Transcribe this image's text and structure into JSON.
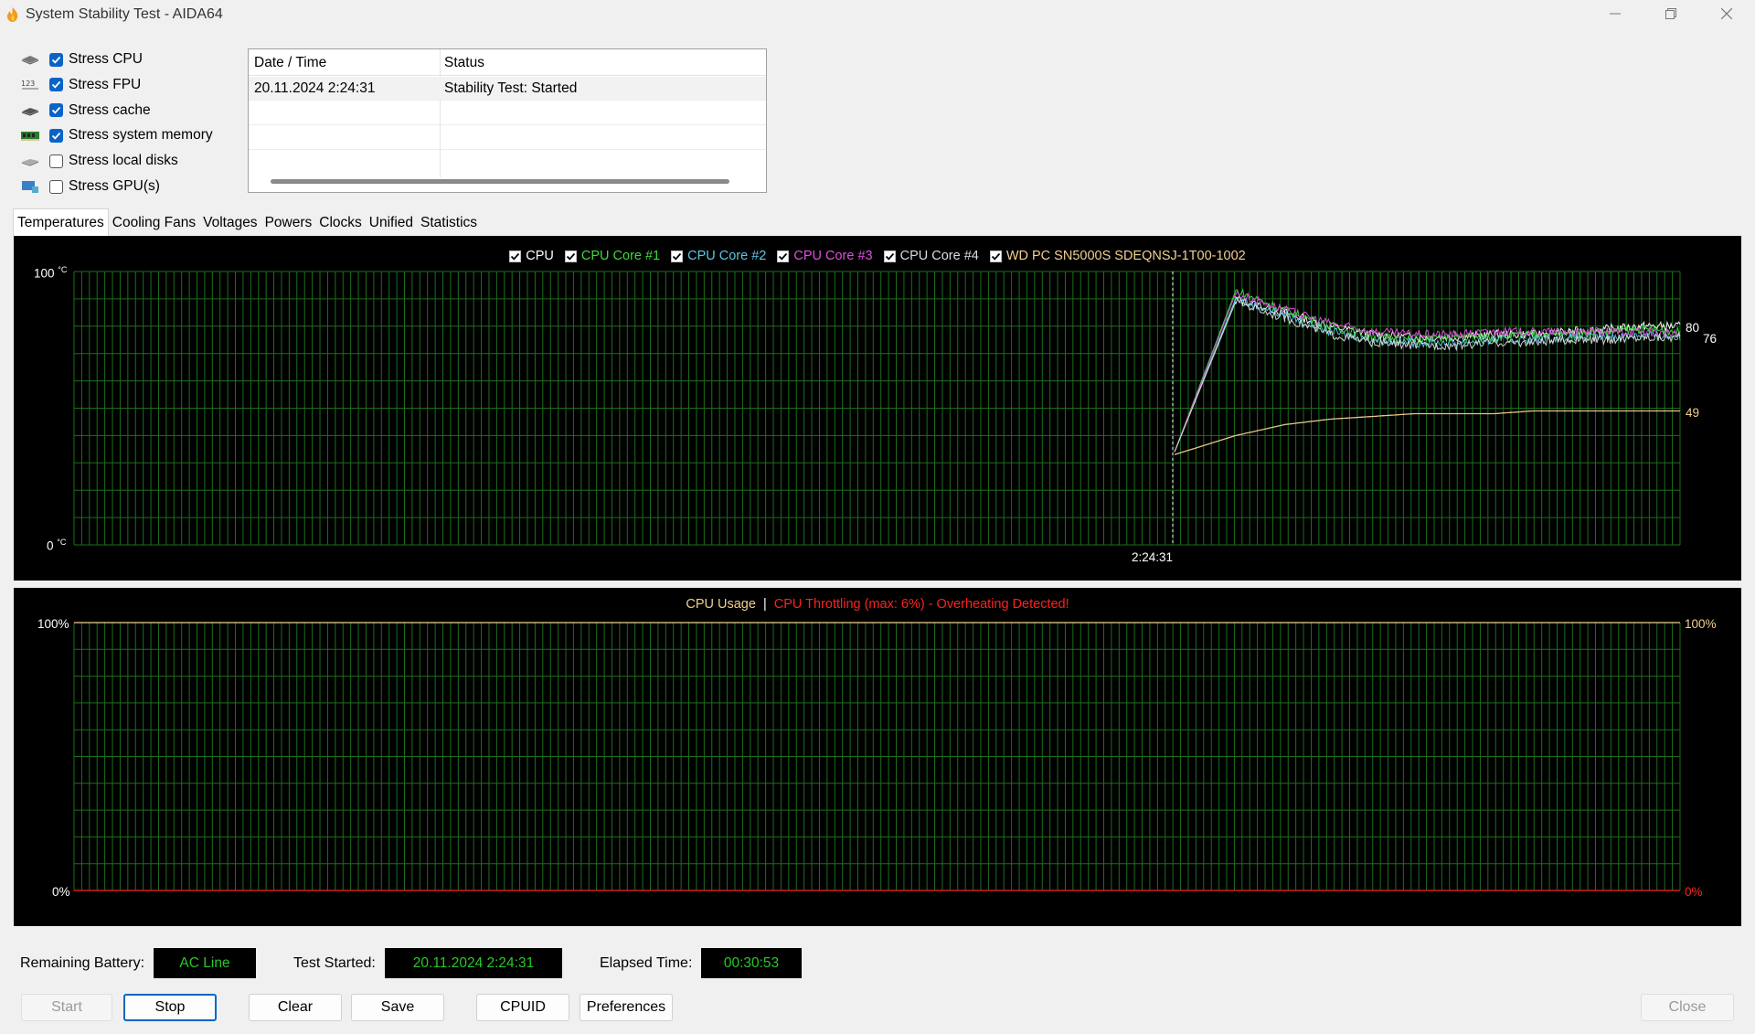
{
  "window": {
    "title": "System Stability Test - AIDA64"
  },
  "stress_options": [
    {
      "label": "Stress CPU",
      "checked": true,
      "icon": "cpu-chip-icon"
    },
    {
      "label": "Stress FPU",
      "checked": true,
      "icon": "fpu-123-icon"
    },
    {
      "label": "Stress cache",
      "checked": true,
      "icon": "cache-chip-icon"
    },
    {
      "label": "Stress system memory",
      "checked": true,
      "icon": "memory-module-icon"
    },
    {
      "label": "Stress local disks",
      "checked": false,
      "icon": "hard-disk-icon"
    },
    {
      "label": "Stress GPU(s)",
      "checked": false,
      "icon": "gpu-monitor-icon"
    }
  ],
  "log": {
    "columns": [
      "Date / Time",
      "Status"
    ],
    "rows": [
      [
        "20.11.2024 2:24:31",
        "Stability Test: Started"
      ]
    ]
  },
  "tabs": [
    "Temperatures",
    "Cooling Fans",
    "Voltages",
    "Powers",
    "Clocks",
    "Unified",
    "Statistics"
  ],
  "active_tab": "Temperatures",
  "temperature_chart": {
    "legend": [
      {
        "label": "CPU",
        "color": "#ffffff",
        "checked": true
      },
      {
        "label": "CPU Core #1",
        "color": "#3cdc3c",
        "checked": true
      },
      {
        "label": "CPU Core #2",
        "color": "#5ac8e6",
        "checked": true
      },
      {
        "label": "CPU Core #3",
        "color": "#e050e0",
        "checked": true
      },
      {
        "label": "CPU Core #4",
        "color": "#dcdcdc",
        "checked": true
      },
      {
        "label": "WD PC SN5000S SDEQNSJ-1T00-1002",
        "color": "#f0d090",
        "checked": true
      }
    ],
    "y_top_label": "100",
    "y_bottom_label": "0",
    "unit": "°C",
    "x_marker_label": "2:24:31",
    "current_values": [
      "80",
      "76",
      "49"
    ]
  },
  "usage_chart": {
    "title": "CPU Usage",
    "separator": "|",
    "throttle_text": "CPU Throttling (max: 6%) - Overheating Detected!",
    "left_top": "100%",
    "left_bottom": "0%",
    "right_top": "100%",
    "right_bottom": "0%"
  },
  "chart_data": [
    {
      "type": "line",
      "ylim": [
        0,
        100
      ],
      "x": [
        "2:24:31"
      ],
      "series": [
        {
          "name": "CPU",
          "values": [
            34,
            90,
            85,
            80,
            77,
            76,
            76,
            77,
            77,
            78,
            79,
            80,
            80
          ]
        },
        {
          "name": "CPU Core #1",
          "values": [
            34,
            93,
            86,
            80,
            76,
            75,
            76,
            76,
            77,
            77,
            78,
            79,
            78
          ]
        },
        {
          "name": "CPU Core #2",
          "values": [
            34,
            90,
            84,
            78,
            75,
            74,
            74,
            75,
            75,
            76,
            76,
            77,
            76
          ]
        },
        {
          "name": "CPU Core #3",
          "values": [
            34,
            92,
            86,
            81,
            78,
            77,
            77,
            78,
            78,
            78,
            78,
            78,
            77
          ]
        },
        {
          "name": "CPU Core #4",
          "values": [
            34,
            89,
            83,
            77,
            74,
            73,
            73,
            74,
            74,
            75,
            75,
            76,
            76
          ]
        },
        {
          "name": "WD PC SN5000S SDEQNSJ-1T00-1002",
          "values": [
            33,
            40,
            44,
            46,
            47,
            48,
            48,
            48,
            49,
            49,
            49,
            49,
            49
          ]
        }
      ]
    },
    {
      "type": "line",
      "ylim": [
        0,
        100
      ],
      "series": [
        {
          "name": "CPU Usage",
          "values": [
            100,
            100,
            100,
            100,
            100,
            100,
            100,
            100,
            100,
            100,
            100,
            100,
            100
          ]
        },
        {
          "name": "CPU Throttling",
          "values": [
            0,
            0,
            0,
            0,
            0,
            0,
            0,
            0,
            0,
            0,
            0,
            0,
            0
          ]
        }
      ]
    }
  ],
  "status": {
    "battery_label": "Remaining Battery:",
    "battery_value": "AC Line",
    "started_label": "Test Started:",
    "started_value": "20.11.2024 2:24:31",
    "elapsed_label": "Elapsed Time:",
    "elapsed_value": "00:30:53"
  },
  "buttons": {
    "start": "Start",
    "stop": "Stop",
    "clear": "Clear",
    "save": "Save",
    "cpuid": "CPUID",
    "preferences": "Preferences",
    "close": "Close"
  }
}
